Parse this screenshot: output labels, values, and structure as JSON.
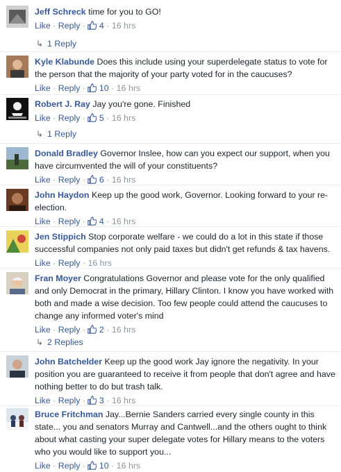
{
  "comments": [
    {
      "author": "Jeff Schreck",
      "text": "time for you to GO!",
      "like": "Like",
      "reply": "Reply",
      "likes": "4",
      "time": "16 hrs",
      "replies": "1 Reply",
      "avatar_color": "#5a5a5a"
    },
    {
      "author": "Kyle Klabunde",
      "text": "Does this include using your superdelegate status to vote for the person that the majority of your party voted for in the caucuses?",
      "like": "Like",
      "reply": "Reply",
      "likes": "10",
      "time": "16 hrs",
      "avatar_color": "#8a5a3a"
    },
    {
      "author": "Robert J. Ray",
      "text": "Jay you're gone. Finished",
      "like": "Like",
      "reply": "Reply",
      "likes": "5",
      "time": "16 hrs",
      "replies": "1 Reply",
      "avatar_color": "#111111"
    },
    {
      "author": "Donald Bradley",
      "text": "Governor Inslee, how can you expect our support, when you have circumvented the will of your constituents?",
      "like": "Like",
      "reply": "Reply",
      "likes": "6",
      "time": "16 hrs",
      "avatar_color": "#6b8aa8"
    },
    {
      "author": "John Haydon",
      "text": "Keep up the good work, Governor. Looking forward to your re-election.",
      "like": "Like",
      "reply": "Reply",
      "likes": "4",
      "time": "16 hrs",
      "avatar_color": "#7a4a30"
    },
    {
      "author": "Jen Stippich",
      "text": "Stop corporate welfare - we could do a lot in this state if those successful companies not only paid taxes but didn't get refunds & tax havens.",
      "like": "Like",
      "reply": "Reply",
      "time": "16 hrs",
      "avatar_color": "#d8c040"
    },
    {
      "author": "Fran Moyer",
      "text": "Congratulations Governor and please vote for the only qualified and only Democrat in the primary, Hillary Clinton. I know you have worked with both and made a wise decision. Too few people could attend the caucuses to change any informed voter's mind",
      "like": "Like",
      "reply": "Reply",
      "likes": "2",
      "time": "16 hrs",
      "replies": "2 Replies",
      "avatar_color": "#c9b89a"
    },
    {
      "author": "John Batchelder",
      "text": "Keep up the good work Jay ignore the negativity. In your position you are guaranteed to receive it from people that don't agree and have nothing better to do but trash talk.",
      "like": "Like",
      "reply": "Reply",
      "likes": "3",
      "time": "16 hrs",
      "avatar_color": "#3a4a5a"
    },
    {
      "author": "Bruce Fritchman",
      "text": "Jay...Bernie Sanders carried every single county in this state... you and senators Murray and Cantwell...and the others ought to think about what casting your super delegate votes for Hillary means to the voters who you would like to support you...",
      "like": "Like",
      "reply": "Reply",
      "likes": "10",
      "time": "16 hrs",
      "avatar_color": "#9fb4c8"
    }
  ],
  "colors": {
    "link": "#365899",
    "text": "#1d2129",
    "meta": "#90949c"
  }
}
